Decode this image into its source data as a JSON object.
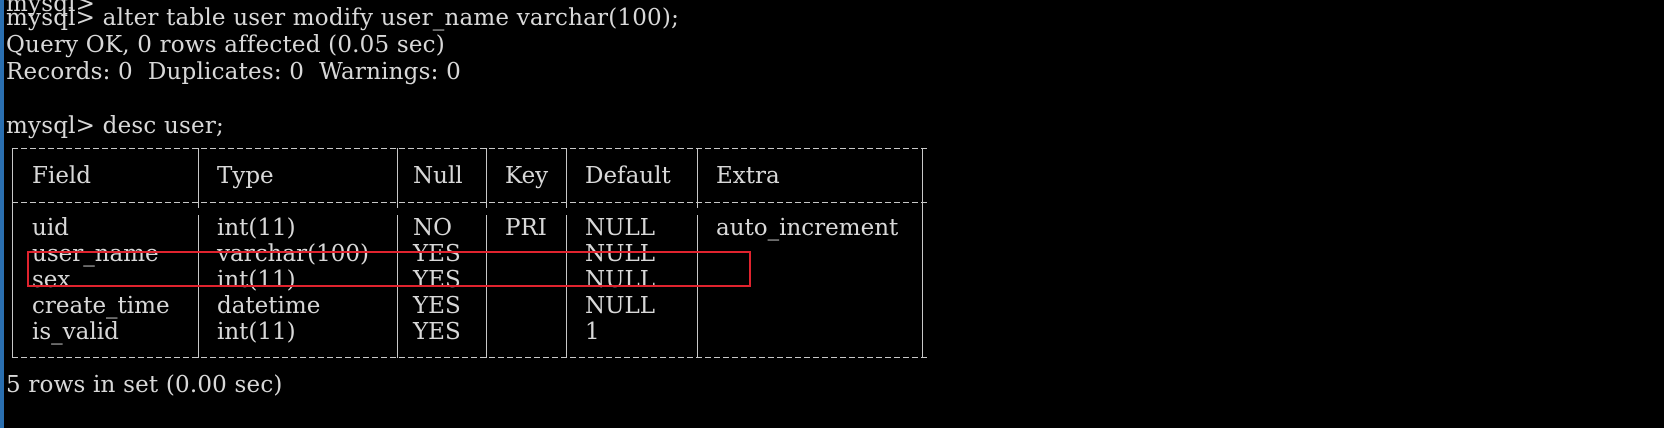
{
  "terminal": {
    "lines": {
      "alter_cmd": "mysql> alter table user modify user_name varchar(100);",
      "query_ok": "Query OK, 0 rows affected (0.05 sec)",
      "records": "Records: 0  Duplicates: 0  Warnings: 0",
      "desc_cmd": "mysql> desc user;",
      "rows_in_set": "5 rows in set (0.00 sec)"
    },
    "table": {
      "headers": [
        "Field",
        "Type",
        "Null",
        "Key",
        "Default",
        "Extra"
      ],
      "rows": [
        [
          "uid",
          "int(11)",
          "NO",
          "PRI",
          "NULL",
          "auto_increment"
        ],
        [
          "user_name",
          "varchar(100)",
          "YES",
          "",
          "NULL",
          ""
        ],
        [
          "sex",
          "int(11)",
          "YES",
          "",
          "NULL",
          ""
        ],
        [
          "create_time",
          "datetime",
          "YES",
          "",
          "NULL",
          ""
        ],
        [
          "is_valid",
          "int(11)",
          "YES",
          "",
          "1",
          ""
        ]
      ]
    },
    "highlight_color": "#e0232e",
    "text_color": "#d8d8d8",
    "background_color": "#000000"
  }
}
